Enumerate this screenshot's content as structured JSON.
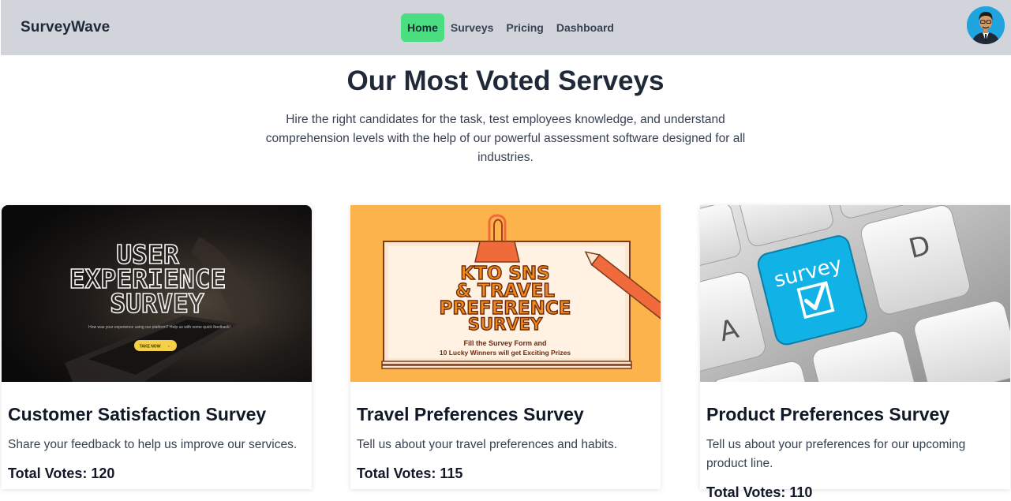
{
  "navbar": {
    "brand": "SurveyWave",
    "links": [
      {
        "label": "Home",
        "active": true
      },
      {
        "label": "Surveys",
        "active": false
      },
      {
        "label": "Pricing",
        "active": false
      },
      {
        "label": "Dashboard",
        "active": false
      }
    ],
    "active_color": "#4ade80",
    "background": "#d1d5db"
  },
  "hero": {
    "title": "Our Most Voted Serveys",
    "subtitle": "Hire the right candidates for the task, test employees knowledge, and understand comprehension levels with the help of our powerful assessment software designed for all industries."
  },
  "cards": [
    {
      "title": "Customer Satisfaction Survey",
      "description": "Share your feedback to help us improve our services.",
      "votes": "Total Votes: 120",
      "image": {
        "headline": [
          "USER",
          "EXPERIENCE",
          "SURVEY"
        ],
        "caption": "How was your experience using our platform? Help us with some quick feedback!",
        "button": "TAKE NOW"
      }
    },
    {
      "title": "Travel Preferences Survey",
      "description": "Tell us about your travel preferences and habits.",
      "votes": "Total Votes: 115",
      "image": {
        "headline": [
          "KTO SNS",
          "& TRAVEL",
          "PREFERENCE",
          "SURVEY"
        ],
        "caption": [
          "Fill the Survey Form and",
          "10 Lucky Winners will get Exciting Prizes"
        ]
      }
    },
    {
      "title": "Product Preferences Survey",
      "description": "Tell us about your preferences for our upcoming product line.",
      "votes": "Total Votes: 110",
      "image": {
        "key_label": "survey",
        "other_keys": [
          "A",
          "D"
        ]
      }
    }
  ]
}
